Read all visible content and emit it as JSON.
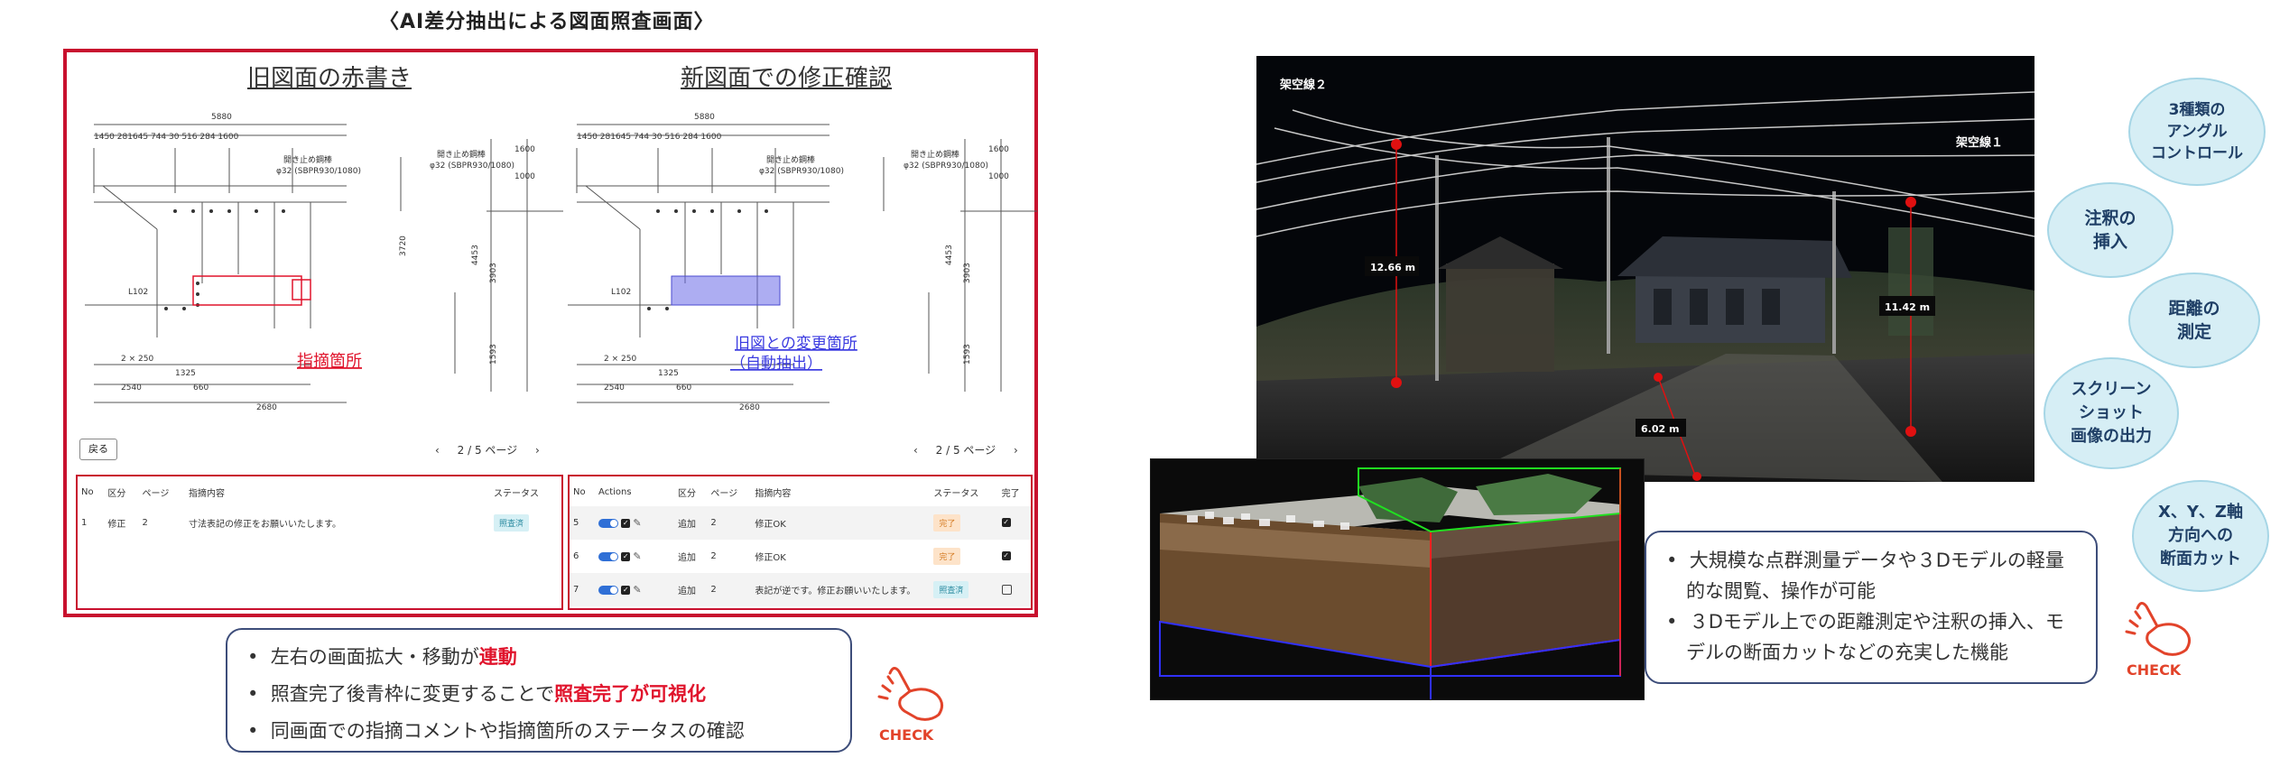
{
  "page": {
    "title": "〈AI差分抽出による図面照査画面〉"
  },
  "left_panel": {
    "old_title": "旧図面の赤書き",
    "new_title": "新図面での修正確認",
    "old_annotation": "指摘箇所",
    "new_annotation_line1": "旧図との変更箇所",
    "new_annotation_line2": "（自動抽出）",
    "back_label": "戻る",
    "pager": {
      "prev": "‹",
      "text": "2 / 5 ページ",
      "next": "›"
    },
    "drawing_labels": {
      "dim_top": "5880",
      "dim_row": "1450   281645   744   30 516 284   1600",
      "steel_label": "開き止め鋼棒",
      "steel_spec": "φ32 (SBPR930/1080)",
      "dim_bottom1": "2540",
      "dim_bottom2": "2680",
      "dim_1325": "1325",
      "dim_1000": "1000",
      "dim_1600": "1600",
      "dim_4453": "4453",
      "dim_3903": "3903",
      "dim_1593": "1593",
      "dim_3720": "3720",
      "dim_L102": "L102",
      "dim_2x250": "2 × 250",
      "dim_660": "660"
    }
  },
  "old_table": {
    "headers": [
      "No",
      "区分",
      "ページ",
      "指摘内容",
      "ステータス"
    ],
    "rows": [
      {
        "no": "1",
        "kubun": "修正",
        "page": "2",
        "content": "寸法表記の修正をお願いいたします。",
        "status": "照査済"
      }
    ]
  },
  "new_table": {
    "headers": [
      "No",
      "Actions",
      "区分",
      "ページ",
      "指摘内容",
      "ステータス",
      "完了"
    ],
    "rows": [
      {
        "no": "5",
        "kubun": "追加",
        "page": "2",
        "content": "修正OK",
        "status": "完了"
      },
      {
        "no": "6",
        "kubun": "追加",
        "page": "2",
        "content": "修正OK",
        "status": "完了"
      },
      {
        "no": "7",
        "kubun": "追加",
        "page": "2",
        "content": "表記が逆です。修正お願いいたします。",
        "status": "照査済"
      }
    ]
  },
  "left_callout": {
    "b1_pre": "左右の画面拡大・移動が",
    "b1_em": "連動",
    "b2_pre": "照査完了後青枠に変更することで",
    "b2_em": "照査完了が可視化",
    "b3": "同画面での指摘コメントや指摘箇所のステータスの確認"
  },
  "pointcloud": {
    "line2_label": "架空線２",
    "line1_label": "架空線１",
    "m1": "12.66 m",
    "m2": "11.42 m",
    "m3": "6.02 m"
  },
  "right_callout": {
    "b1": "大規模な点群測量データや３Dモデルの軽量的な閲覧、操作が可能",
    "b2": "３Dモデル上での距離測定や注釈の挿入、モデルの断面カットなどの充実した機能"
  },
  "features": [
    "3種類の\nアングル\nコントロール",
    "注釈の\n挿入",
    "距離の\n測定",
    "スクリーン\nショット\n画像の出力",
    "X、Y、Z軸\n方向への\n断面カット"
  ],
  "check_label": "CHECK",
  "colors": {
    "accent_red": "#c8102e",
    "callout_border": "#3d4d7a",
    "circle_fill": "#d6eef5",
    "circle_text": "#1f3f66",
    "diff_blue": "#6a6ae8"
  },
  "icons": [
    "toggle-switch-icon",
    "checkbox-checked-icon",
    "checkbox-empty-icon",
    "pencil-edit-icon",
    "pointing-hand-check-icon"
  ]
}
